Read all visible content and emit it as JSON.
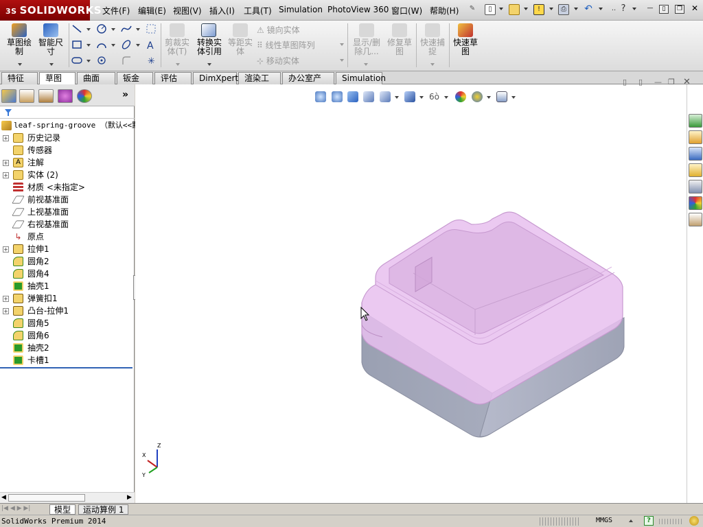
{
  "app": {
    "logo": "SOLIDWORKS",
    "logo_prefix": "3S",
    "menu": [
      "文件(F)",
      "编辑(E)",
      "视图(V)",
      "插入(I)",
      "工具(T)",
      "Simulation",
      "PhotoView 360",
      "窗口(W)",
      "帮助(H)"
    ]
  },
  "ribbon": {
    "sketch": "草图绘制",
    "smart_dim": "智能尺寸",
    "trim": "剪裁实体(T)",
    "convert": "转换实体引用",
    "offset": "等距实体",
    "mirror": "镜向实体",
    "linear_pattern": "线性草图阵列",
    "move": "移动实体",
    "display_delete": "显示/删除几...",
    "repair": "修复草图",
    "quick_snap": "快速捕捉",
    "rapid_sketch": "快速草图"
  },
  "command_tabs": [
    "特征",
    "草图",
    "曲面",
    "钣金",
    "评估",
    "DimXpert",
    "渲染工具",
    "办公室产品",
    "Simulation"
  ],
  "active_command_tab": "草图",
  "tree": {
    "root": "leaf-spring-groove （默认<<默",
    "nodes": [
      "历史记录",
      "传感器",
      "注解",
      "实体 (2)",
      "材质 <未指定>",
      "前视基准面",
      "上视基准面",
      "右视基准面",
      "原点",
      "拉伸1",
      "圆角2",
      "圆角4",
      "抽壳1",
      "弹簧扣1",
      "凸台-拉伸1",
      "圆角5",
      "圆角6",
      "抽壳2",
      "卡槽1"
    ]
  },
  "bottom_tabs": [
    "模型",
    "运动算例 1"
  ],
  "status": {
    "text": "SolidWorks Premium 2014",
    "units": "MMGS"
  },
  "triad": {
    "x": "X",
    "y": "Y",
    "z": "Z"
  },
  "colors": {
    "accent": "#b01010",
    "model_base": "#a8acbc",
    "model_lid": "#e2b9e6"
  }
}
